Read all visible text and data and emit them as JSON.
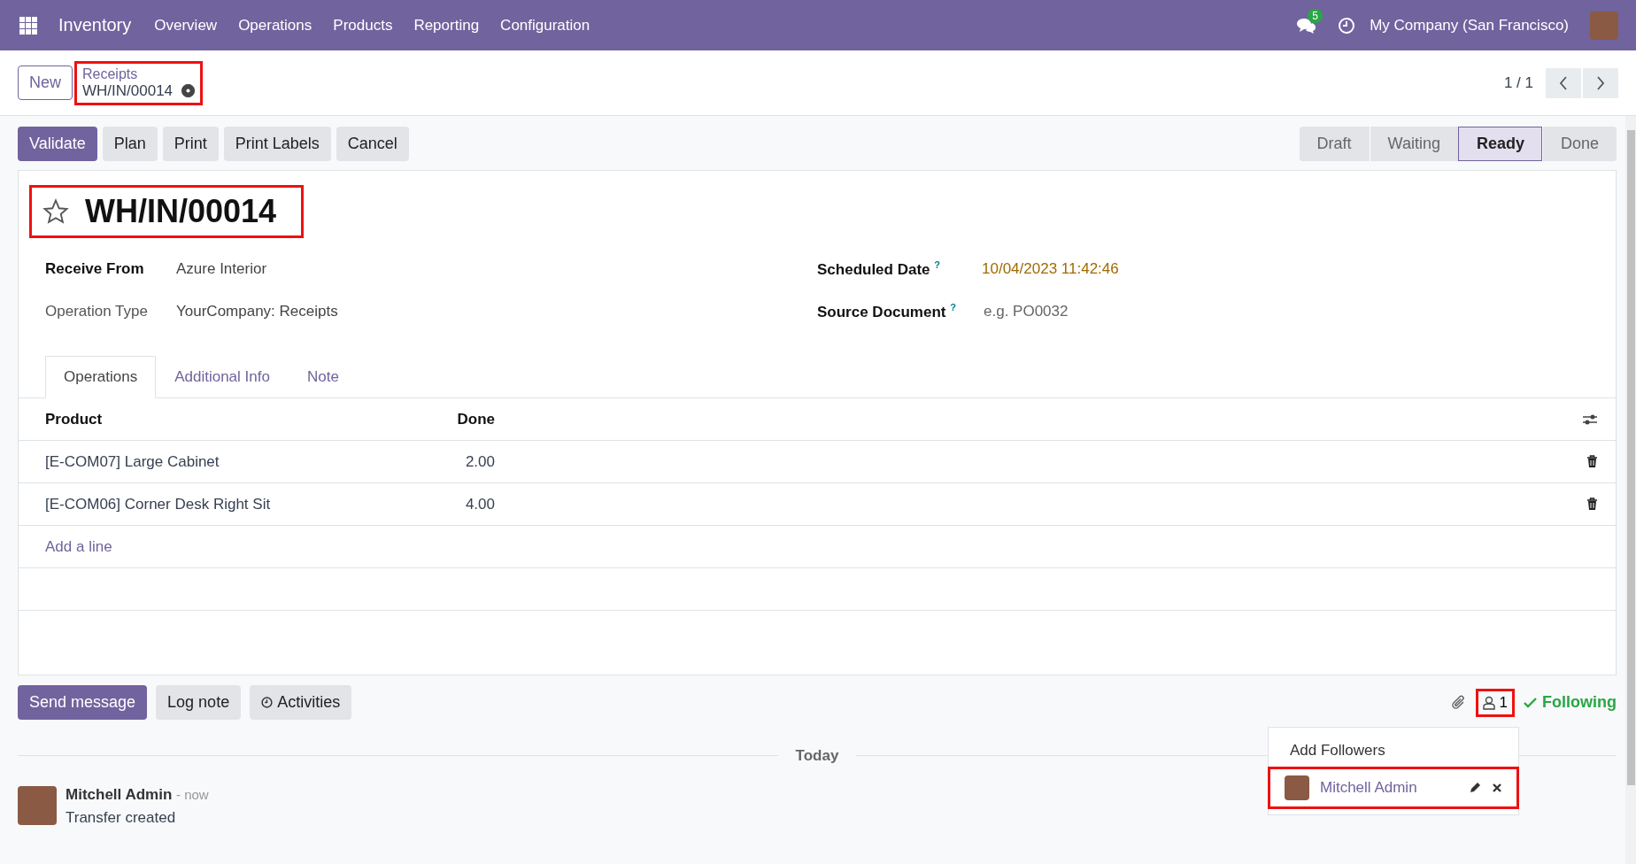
{
  "navbar": {
    "app": "Inventory",
    "menu": [
      "Overview",
      "Operations",
      "Products",
      "Reporting",
      "Configuration"
    ],
    "messages_badge": "5",
    "company": "My Company (San Francisco)"
  },
  "control_panel": {
    "new_button": "New",
    "breadcrumb": "Receipts",
    "record": "WH/IN/00014",
    "pager": "1 / 1"
  },
  "actions": [
    {
      "label": "Validate",
      "primary": true
    },
    {
      "label": "Plan",
      "primary": false
    },
    {
      "label": "Print",
      "primary": false
    },
    {
      "label": "Print Labels",
      "primary": false
    },
    {
      "label": "Cancel",
      "primary": false
    }
  ],
  "stages": [
    {
      "label": "Draft",
      "selected": false
    },
    {
      "label": "Waiting",
      "selected": false
    },
    {
      "label": "Ready",
      "selected": true
    },
    {
      "label": "Done",
      "selected": false
    }
  ],
  "form": {
    "title": "WH/IN/00014",
    "favorite": false,
    "left_fields": [
      {
        "label": "Receive From",
        "value": "Azure Interior",
        "bold": true
      },
      {
        "label": "Operation Type",
        "value": "YourCompany: Receipts",
        "bold": false
      }
    ],
    "right_fields": [
      {
        "label": "Scheduled Date",
        "help": "?",
        "value": "10/04/2023 11:42:46",
        "kind": "date"
      },
      {
        "label": "Source Document",
        "help": "?",
        "placeholder": "e.g. PO0032",
        "kind": "input"
      }
    ],
    "tabs": [
      {
        "label": "Operations",
        "selected": true
      },
      {
        "label": "Additional Info",
        "selected": false
      },
      {
        "label": "Note",
        "selected": false
      }
    ],
    "table": {
      "columns": [
        "Product",
        "Done"
      ],
      "rows": [
        [
          "[E-COM07] Large Cabinet",
          "2.00"
        ],
        [
          "[E-COM06] Corner Desk Right Sit",
          "4.00"
        ]
      ],
      "add_line": "Add a line"
    }
  },
  "chatter": {
    "buttons": [
      {
        "label": "Send message",
        "primary": true
      },
      {
        "label": "Log note",
        "primary": false
      },
      {
        "label": "Activities",
        "primary": false
      }
    ],
    "followers_count": "1",
    "following": "Following",
    "followers_menu": {
      "add": "Add Followers",
      "followers": [
        {
          "name": "Mitchell Admin"
        }
      ]
    },
    "date_separator": "Today",
    "messages": [
      {
        "author": "Mitchell Admin",
        "time": "- now",
        "body": "Transfer created"
      }
    ]
  }
}
